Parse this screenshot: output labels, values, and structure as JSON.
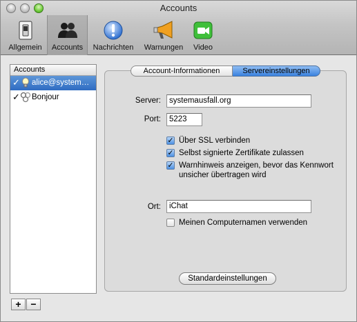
{
  "window": {
    "title": "Accounts"
  },
  "toolbar": {
    "items": [
      {
        "label": "Allgemein",
        "icon": "switch-icon"
      },
      {
        "label": "Accounts",
        "icon": "people-icon",
        "selected": true
      },
      {
        "label": "Nachrichten",
        "icon": "exclamation-icon"
      },
      {
        "label": "Warnungen",
        "icon": "megaphone-icon"
      },
      {
        "label": "Video",
        "icon": "video-camera-icon"
      }
    ]
  },
  "sidebar": {
    "header": "Accounts",
    "accounts": [
      {
        "name": "alice@system…",
        "checked": "✓",
        "icon": "jabber-lightbulb-icon",
        "selected": true
      },
      {
        "name": "Bonjour",
        "checked": "✓",
        "icon": "bonjour-icon",
        "selected": false
      }
    ],
    "add_label": "+",
    "remove_label": "−"
  },
  "tabs": [
    {
      "label": "Account-Informationen",
      "active": false
    },
    {
      "label": "Servereinstellungen",
      "active": true
    }
  ],
  "server_settings": {
    "server_label": "Server:",
    "server_value": "systemausfall.org",
    "port_label": "Port:",
    "port_value": "5223",
    "ssl": {
      "label": "Über SSL verbinden",
      "checked": true
    },
    "self_signed": {
      "label": "Selbst signierte Zertifikate zulassen",
      "checked": true
    },
    "warn_insecure": {
      "label_line1": "Warnhinweis anzeigen, bevor das Kennwort",
      "label_line2": "unsicher übertragen wird",
      "checked": true
    },
    "location_label": "Ort:",
    "location_value": "iChat",
    "use_computer_name": {
      "label": "Meinen Computernamen verwenden",
      "checked": false
    },
    "defaults_button": "Standardeinstellungen"
  },
  "colors": {
    "accent": "#3a82df",
    "selection": "#2f6cc2",
    "video_green": "#3fbf3a",
    "warn_orange": "#f0a020"
  }
}
